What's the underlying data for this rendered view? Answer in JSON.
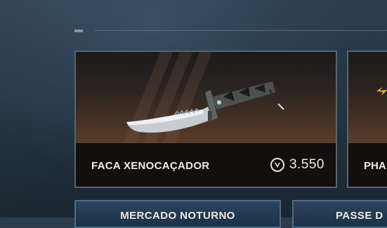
{
  "featured": {
    "item_name": "FACA XENOCAÇADOR",
    "price": "3.550",
    "currency_icon": "valorant-points-icon"
  },
  "side_card": {
    "item_name": "PHA"
  },
  "tiles": [
    {
      "label": "MERCADO NOTURNO"
    },
    {
      "label": "PASSE D"
    }
  ],
  "colors": {
    "background": "#22323f",
    "card_border": "#5a646c",
    "card_footer": "#120f0f",
    "tile_background": "#2c4560",
    "text": "#ece8e1"
  }
}
